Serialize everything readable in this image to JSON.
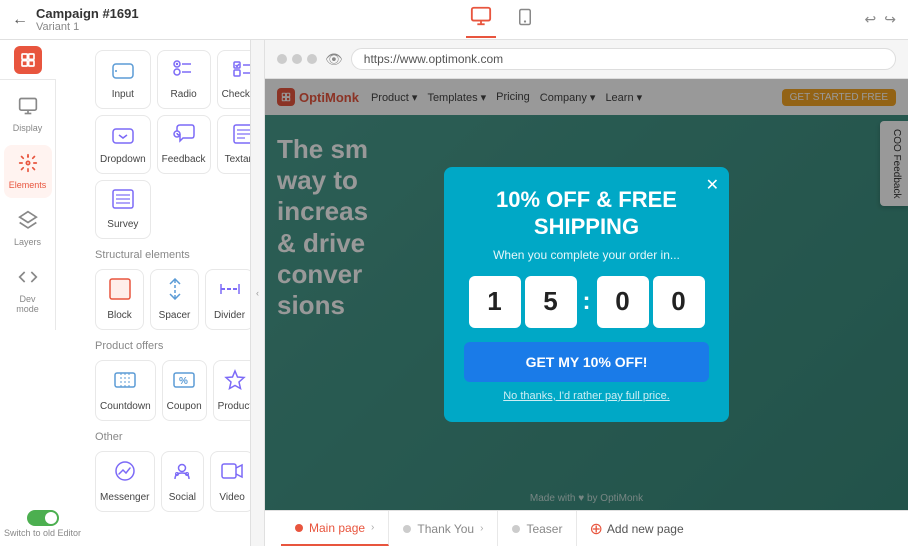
{
  "topbar": {
    "campaign_title": "Campaign #1691",
    "variant_label": "Variant 1",
    "back_icon": "←",
    "desktop_icon": "🖥",
    "mobile_icon": "📱",
    "undo_icon": "↩",
    "redo_icon": "↪"
  },
  "nav": {
    "items": [
      {
        "id": "display",
        "label": "Display",
        "icon": "⊞"
      },
      {
        "id": "elements",
        "label": "Elements",
        "icon": "＋",
        "active": true
      },
      {
        "id": "layers",
        "label": "Layers",
        "icon": "⊟"
      },
      {
        "id": "devmode",
        "label": "Dev mode",
        "icon": "<>"
      }
    ]
  },
  "elements_panel": {
    "sections": [
      {
        "title": "",
        "items": [
          {
            "id": "input",
            "label": "Input",
            "icon": "▭"
          },
          {
            "id": "radio",
            "label": "Radio",
            "icon": "◉"
          },
          {
            "id": "checkbox",
            "label": "Checkbox",
            "icon": "☑"
          },
          {
            "id": "dropdown",
            "label": "Dropdown",
            "icon": "▾"
          },
          {
            "id": "feedback",
            "label": "Feedback",
            "icon": "💬"
          },
          {
            "id": "textarea",
            "label": "Textarea",
            "icon": "▤"
          },
          {
            "id": "survey",
            "label": "Survey",
            "icon": "≡"
          }
        ]
      },
      {
        "title": "Structural elements",
        "items": [
          {
            "id": "block",
            "label": "Block",
            "icon": "▪"
          },
          {
            "id": "spacer",
            "label": "Spacer",
            "icon": "↕"
          },
          {
            "id": "divider",
            "label": "Divider",
            "icon": "—"
          }
        ]
      },
      {
        "title": "Product offers",
        "items": [
          {
            "id": "countdown",
            "label": "Countdown",
            "icon": "⏱"
          },
          {
            "id": "coupon",
            "label": "Coupon",
            "icon": "%"
          },
          {
            "id": "product",
            "label": "Product",
            "icon": "⭐"
          }
        ]
      },
      {
        "title": "Other",
        "items": [
          {
            "id": "messenger",
            "label": "Messenger",
            "icon": "💬"
          },
          {
            "id": "social",
            "label": "Social",
            "icon": "👤"
          },
          {
            "id": "video",
            "label": "Video",
            "icon": "▶"
          }
        ]
      }
    ]
  },
  "browser": {
    "url": "https://www.optimonk.com"
  },
  "popup": {
    "title": "10% OFF & FREE SHIPPING",
    "subtitle": "When you complete your order in...",
    "countdown": {
      "digits": [
        "1",
        "5",
        "0",
        "0"
      ],
      "separator": ":"
    },
    "cta_label": "GET MY 10% OFF!",
    "decline_label": "No thanks, I'd rather pay full price.",
    "close_icon": "✕"
  },
  "website": {
    "logo_text": "OptiMonk",
    "nav_links": [
      "Product ▾",
      "Templates ▾",
      "Pricing",
      "Company ▾",
      "Learn ▾"
    ],
    "nav_cta": "GET STARTED FREE",
    "headline_lines": [
      "The sm",
      "way to",
      "increas",
      "& drive",
      "conver",
      "sions"
    ],
    "footer": "Made with ♥ by OptiMonk"
  },
  "coo_feedback": {
    "label": "COO Feedback"
  },
  "bottom_bar": {
    "tabs": [
      {
        "id": "main",
        "label": "Main page",
        "active": true
      },
      {
        "id": "thankyou",
        "label": "Thank You",
        "active": false
      },
      {
        "id": "teaser",
        "label": "Teaser",
        "active": false
      }
    ],
    "add_page_label": "Add new page"
  },
  "switch_editor": {
    "label": "Switch to old Editor"
  }
}
